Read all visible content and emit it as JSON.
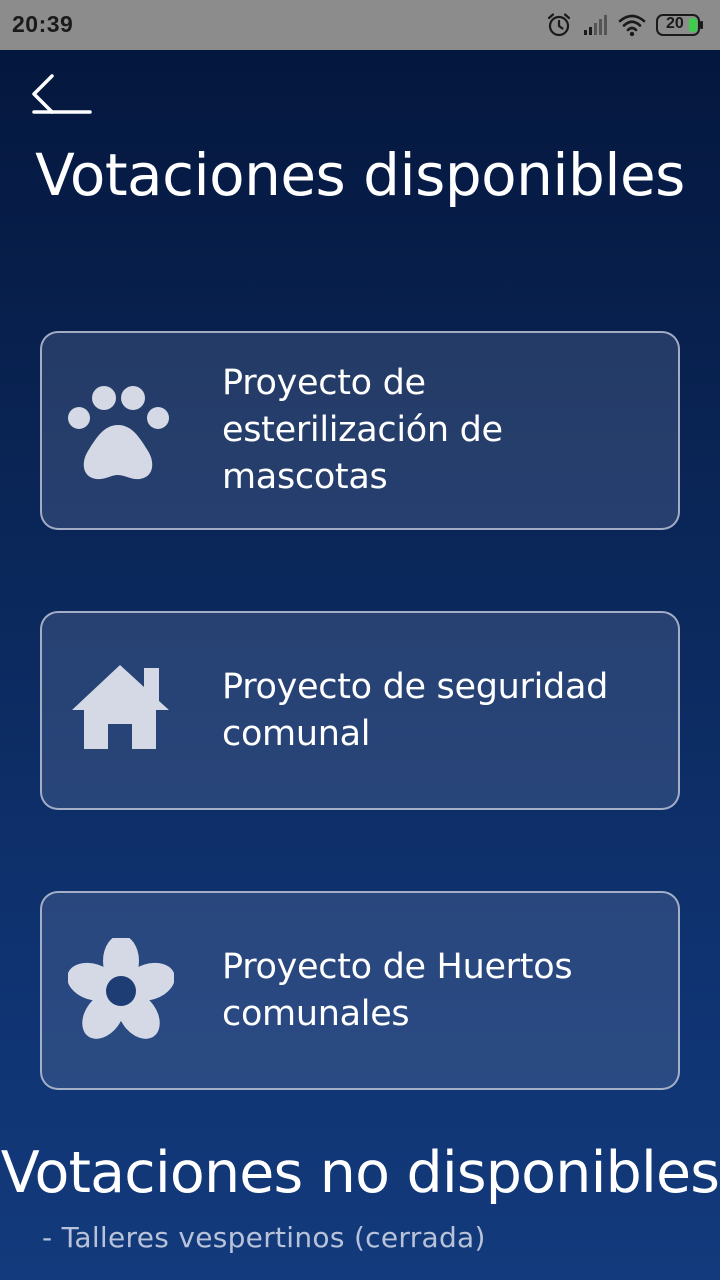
{
  "status_bar": {
    "time": "20:39",
    "battery_level": "20",
    "icons": [
      "alarm-icon",
      "signal-icon",
      "wifi-icon",
      "battery-icon"
    ]
  },
  "header": {
    "back_icon": "arrow-left-icon",
    "title": "Votaciones disponibles"
  },
  "available_votes": [
    {
      "icon": "paw-icon",
      "label": "Proyecto de esterilización de mascotas"
    },
    {
      "icon": "house-icon",
      "label": "Proyecto de seguridad comunal"
    },
    {
      "icon": "flower-icon",
      "label": "Proyecto de Huertos comunales"
    }
  ],
  "unavailable": {
    "title": "Votaciones no disponibles",
    "items": [
      {
        "label": "- Talleres vespertinos (cerrada)"
      }
    ]
  },
  "colors": {
    "background_top": "#04173e",
    "background_bottom": "#133a7c",
    "icon_fill": "#d4d9e5",
    "status_bar": "#8c8c8c",
    "battery_fill": "#3ccd4a"
  }
}
